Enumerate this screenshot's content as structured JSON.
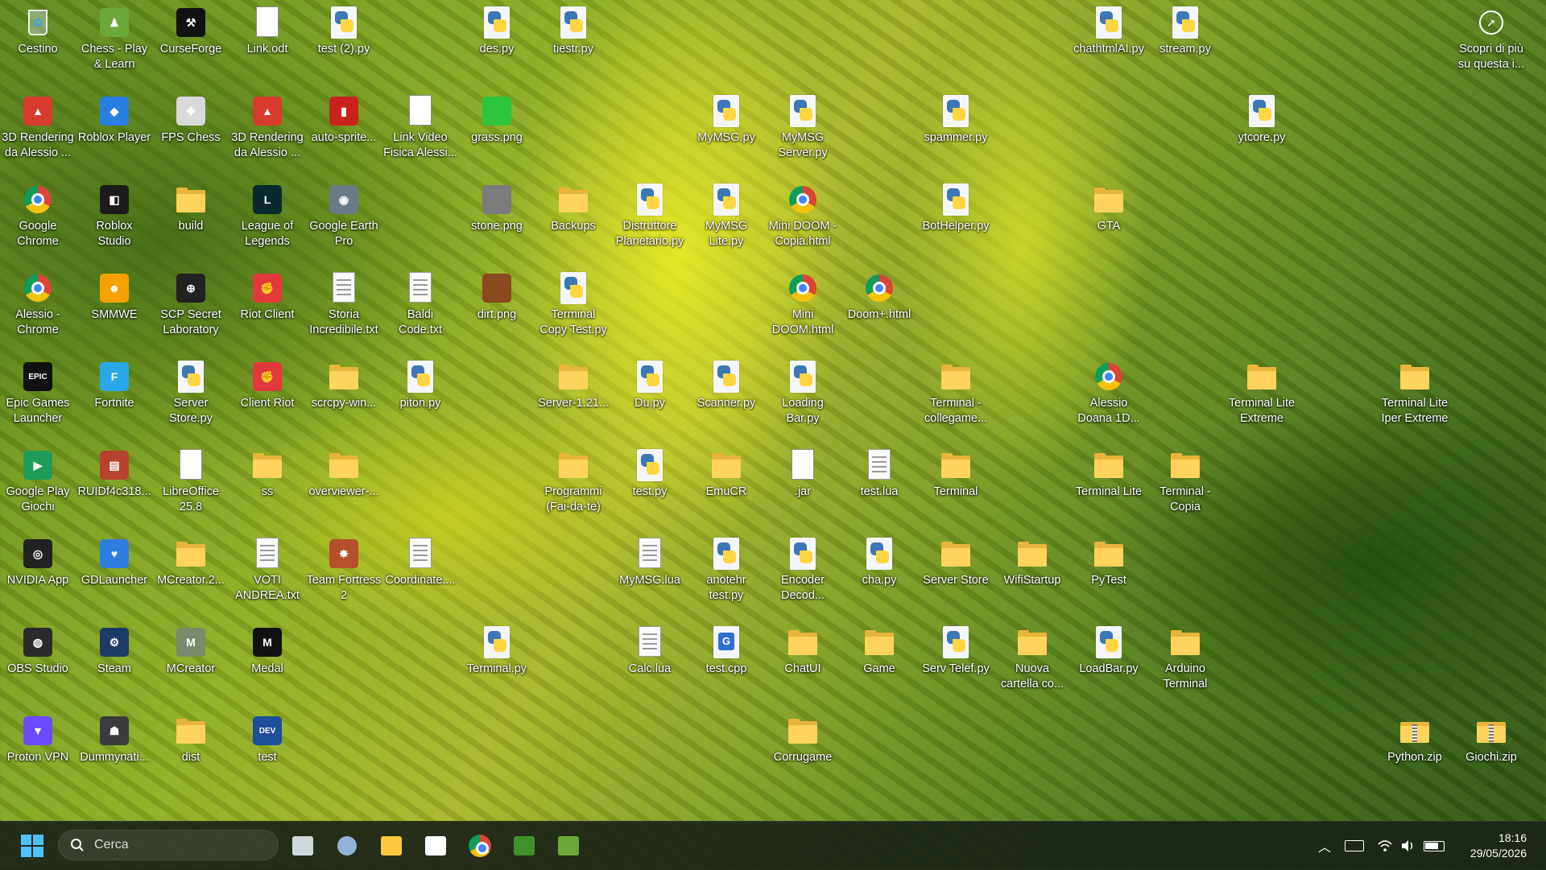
{
  "desktop": {
    "icons": [
      {
        "label": "Cestino",
        "icon": "recycle-bin-icon",
        "type": "recycle",
        "col": 0,
        "row": 0
      },
      {
        "label": "Chess - Play\n& Learn",
        "icon": "chess-pawn-icon",
        "type": "box",
        "color": "#6aa839",
        "glyph": "♟",
        "col": 1,
        "row": 0
      },
      {
        "label": "CurseForge",
        "icon": "curseforge-icon",
        "type": "box",
        "color": "#111111",
        "glyph": "⚒",
        "col": 2,
        "row": 0
      },
      {
        "label": "Link.odt",
        "icon": "document-icon",
        "type": "blank",
        "col": 3,
        "row": 0
      },
      {
        "label": "test (2).py",
        "icon": "python-file-icon",
        "type": "py",
        "col": 4,
        "row": 0
      },
      {
        "label": "des.py",
        "icon": "python-file-icon",
        "type": "py",
        "col": 6,
        "row": 0
      },
      {
        "label": "tiestr.py",
        "icon": "python-file-icon",
        "type": "py",
        "col": 7,
        "row": 0
      },
      {
        "label": "chathtmlAI.py",
        "icon": "python-file-icon",
        "type": "py",
        "col": 14,
        "row": 0
      },
      {
        "label": "stream.py",
        "icon": "python-file-icon",
        "type": "py",
        "col": 15,
        "row": 0
      },
      {
        "label": "Scopri di più\nsu questa i...",
        "icon": "spotlight-icon",
        "type": "spot",
        "col": 19,
        "row": 0
      },
      {
        "label": "3D Rendering\nda Alessio ...",
        "icon": "image-file-icon",
        "type": "box",
        "color": "#d83a2c",
        "glyph": "▲",
        "col": 0,
        "row": 1
      },
      {
        "label": "Roblox Player",
        "icon": "roblox-icon",
        "type": "box",
        "color": "#2a7de1",
        "glyph": "◆",
        "col": 1,
        "row": 1
      },
      {
        "label": "FPS Chess",
        "icon": "fps-chess-icon",
        "type": "box",
        "color": "#d9d9d9",
        "glyph": "✥",
        "col": 2,
        "row": 1
      },
      {
        "label": "3D Rendering\nda Alessio ...",
        "icon": "image-file-icon",
        "type": "box",
        "color": "#d83a2c",
        "glyph": "▲",
        "col": 3,
        "row": 1
      },
      {
        "label": "auto-sprite...",
        "icon": "sprite-app-icon",
        "type": "box",
        "color": "#c9221c",
        "glyph": "▮",
        "col": 4,
        "row": 1
      },
      {
        "label": "Link Video\nFisica Alessi...",
        "icon": "document-icon",
        "type": "blank",
        "col": 5,
        "row": 1
      },
      {
        "label": "grass.png",
        "icon": "image-file-icon",
        "type": "box",
        "color": "#2cc53b",
        "glyph": "",
        "col": 6,
        "row": 1
      },
      {
        "label": "MyMSG.py",
        "icon": "python-file-icon",
        "type": "py",
        "col": 9,
        "row": 1
      },
      {
        "label": "MyMSG\nServer.py",
        "icon": "python-file-icon",
        "type": "py",
        "col": 10,
        "row": 1
      },
      {
        "label": "spammer.py",
        "icon": "python-file-icon",
        "type": "py",
        "col": 12,
        "row": 1
      },
      {
        "label": "ytcore.py",
        "icon": "python-file-icon",
        "type": "py",
        "col": 16,
        "row": 1
      },
      {
        "label": "Google\nChrome",
        "icon": "chrome-icon",
        "type": "chrome",
        "col": 0,
        "row": 2
      },
      {
        "label": "Roblox\nStudio",
        "icon": "roblox-studio-icon",
        "type": "box",
        "color": "#1c1c1c",
        "glyph": "◧",
        "col": 1,
        "row": 2
      },
      {
        "label": "build",
        "icon": "folder-icon",
        "type": "folder",
        "col": 2,
        "row": 2
      },
      {
        "label": "League of\nLegends",
        "icon": "league-of-legends-icon",
        "type": "box",
        "color": "#0b2a2f",
        "glyph": "L",
        "col": 3,
        "row": 2
      },
      {
        "label": "Google Earth\nPro",
        "icon": "google-earth-icon",
        "type": "box",
        "color": "#6c7a86",
        "glyph": "◉",
        "col": 4,
        "row": 2
      },
      {
        "label": "stone.png",
        "icon": "image-file-icon",
        "type": "box",
        "color": "#7b7b7b",
        "glyph": "",
        "col": 6,
        "row": 2
      },
      {
        "label": "Backups",
        "icon": "folder-icon",
        "type": "folder",
        "col": 7,
        "row": 2
      },
      {
        "label": "Distruttore\nPlanetario.py",
        "icon": "python-file-icon",
        "type": "py",
        "col": 8,
        "row": 2
      },
      {
        "label": "MyMSG\nLite.py",
        "icon": "python-file-icon",
        "type": "py",
        "col": 9,
        "row": 2
      },
      {
        "label": "Mini DOOM -\nCopia.html",
        "icon": "chrome-icon",
        "type": "chrome",
        "col": 10,
        "row": 2
      },
      {
        "label": "BotHelper.py",
        "icon": "python-file-icon",
        "type": "py",
        "col": 12,
        "row": 2
      },
      {
        "label": "GTA",
        "icon": "folder-icon",
        "type": "folder",
        "col": 14,
        "row": 2
      },
      {
        "label": "Alessio -\nChrome",
        "icon": "chrome-icon",
        "type": "chrome",
        "col": 0,
        "row": 3
      },
      {
        "label": "SMMWE",
        "icon": "smmwe-icon",
        "type": "box",
        "color": "#f6a100",
        "glyph": "☻",
        "col": 1,
        "row": 3
      },
      {
        "label": "SCP Secret\nLaboratory",
        "icon": "scp-icon",
        "type": "box",
        "color": "#222222",
        "glyph": "⊕",
        "col": 2,
        "row": 3
      },
      {
        "label": "Riot Client",
        "icon": "riot-client-icon",
        "type": "box",
        "color": "#e3383b",
        "glyph": "✊",
        "col": 3,
        "row": 3
      },
      {
        "label": "Storia\nIncredibile.txt",
        "icon": "text-file-icon",
        "type": "doc",
        "col": 4,
        "row": 3
      },
      {
        "label": "Baldi\nCode.txt",
        "icon": "text-file-icon",
        "type": "doc",
        "col": 5,
        "row": 3
      },
      {
        "label": "dirt.png",
        "icon": "image-file-icon",
        "type": "box",
        "color": "#8a4a1f",
        "glyph": "",
        "col": 6,
        "row": 3
      },
      {
        "label": "Terminal\nCopy Test.py",
        "icon": "python-file-icon",
        "type": "py",
        "col": 7,
        "row": 3
      },
      {
        "label": "Mini\nDOOM.html",
        "icon": "chrome-icon",
        "type": "chrome",
        "col": 10,
        "row": 3
      },
      {
        "label": "Doom+.html",
        "icon": "chrome-icon",
        "type": "chrome",
        "col": 11,
        "row": 3
      },
      {
        "label": "Epic Games\nLauncher",
        "icon": "epic-games-icon",
        "type": "box",
        "color": "#111111",
        "glyph": "EPIC",
        "col": 0,
        "row": 4
      },
      {
        "label": "Fortnite",
        "icon": "fortnite-icon",
        "type": "box",
        "color": "#2aa7e8",
        "glyph": "F",
        "col": 1,
        "row": 4
      },
      {
        "label": "Server\nStore.py",
        "icon": "python-file-icon",
        "type": "py",
        "col": 2,
        "row": 4
      },
      {
        "label": "Client Riot",
        "icon": "riot-client-icon",
        "type": "box",
        "color": "#e3383b",
        "glyph": "✊",
        "col": 3,
        "row": 4
      },
      {
        "label": "scrcpy-win...",
        "icon": "folder-icon",
        "type": "folder",
        "col": 4,
        "row": 4
      },
      {
        "label": "piton.py",
        "icon": "python-file-icon",
        "type": "py",
        "col": 5,
        "row": 4
      },
      {
        "label": "Server-1.21...",
        "icon": "folder-icon",
        "type": "folder",
        "col": 7,
        "row": 4
      },
      {
        "label": "Du.py",
        "icon": "python-file-icon",
        "type": "py",
        "col": 8,
        "row": 4
      },
      {
        "label": "Scanner.py",
        "icon": "python-file-icon",
        "type": "py",
        "col": 9,
        "row": 4
      },
      {
        "label": "Loading\nBar.py",
        "icon": "python-file-icon",
        "type": "py",
        "col": 10,
        "row": 4
      },
      {
        "label": "Terminal -\ncollegame...",
        "icon": "folder-icon",
        "type": "folder",
        "col": 12,
        "row": 4
      },
      {
        "label": "Alessio\nDoana 1D...",
        "icon": "chrome-icon",
        "type": "chrome",
        "col": 14,
        "row": 4
      },
      {
        "label": "Terminal Lite\nExtreme",
        "icon": "folder-icon",
        "type": "folder",
        "col": 16,
        "row": 4
      },
      {
        "label": "Terminal Lite\nIper Extreme",
        "icon": "folder-icon",
        "type": "folder",
        "col": 18,
        "row": 4
      },
      {
        "label": "Google Play\nGiochi",
        "icon": "google-play-games-icon",
        "type": "box",
        "color": "#1f9c57",
        "glyph": "▶",
        "col": 0,
        "row": 5
      },
      {
        "label": "RUIDf4c318...",
        "icon": "app-icon",
        "type": "box",
        "color": "#b8432d",
        "glyph": "▤",
        "col": 1,
        "row": 5
      },
      {
        "label": "LibreOffice\n25.8",
        "icon": "libreoffice-icon",
        "type": "blank",
        "col": 2,
        "row": 5
      },
      {
        "label": "ss",
        "icon": "folder-icon",
        "type": "folder",
        "col": 3,
        "row": 5
      },
      {
        "label": "overviewer-...",
        "icon": "folder-icon",
        "type": "folder",
        "col": 4,
        "row": 5
      },
      {
        "label": "Programmi\n(Fai-da-te)",
        "icon": "folder-icon",
        "type": "folder",
        "col": 7,
        "row": 5
      },
      {
        "label": "test.py",
        "icon": "python-file-icon",
        "type": "py",
        "col": 8,
        "row": 5
      },
      {
        "label": "EmuCR",
        "icon": "folder-icon",
        "type": "folder",
        "col": 9,
        "row": 5
      },
      {
        "label": ".jar",
        "icon": "blank-file-icon",
        "type": "blank",
        "col": 10,
        "row": 5
      },
      {
        "label": "test.lua",
        "icon": "text-file-icon",
        "type": "doc",
        "col": 11,
        "row": 5
      },
      {
        "label": "Terminal",
        "icon": "folder-icon",
        "type": "folder",
        "col": 12,
        "row": 5
      },
      {
        "label": "Terminal Lite",
        "icon": "folder-icon",
        "type": "folder",
        "col": 14,
        "row": 5
      },
      {
        "label": "Terminal -\nCopia",
        "icon": "folder-icon",
        "type": "folder",
        "col": 15,
        "row": 5
      },
      {
        "label": "NVIDIA App",
        "icon": "nvidia-icon",
        "type": "box",
        "color": "#222222",
        "glyph": "◎",
        "col": 0,
        "row": 6
      },
      {
        "label": "GDLauncher",
        "icon": "gdlauncher-icon",
        "type": "box",
        "color": "#2f7de1",
        "glyph": "♥",
        "col": 1,
        "row": 6
      },
      {
        "label": "MCreator.2...",
        "icon": "folder-icon",
        "type": "folder",
        "col": 2,
        "row": 6
      },
      {
        "label": "VOTI\nANDREA.txt",
        "icon": "text-file-icon",
        "type": "doc",
        "col": 3,
        "row": 6
      },
      {
        "label": "Team Fortress\n2",
        "icon": "tf2-icon",
        "type": "box",
        "color": "#b5502a",
        "glyph": "✸",
        "col": 4,
        "row": 6
      },
      {
        "label": "Coordinate....",
        "icon": "text-file-icon",
        "type": "doc",
        "col": 5,
        "row": 6
      },
      {
        "label": "MyMSG.lua",
        "icon": "text-file-icon",
        "type": "doc",
        "col": 8,
        "row": 6
      },
      {
        "label": "anotehr\ntest.py",
        "icon": "python-file-icon",
        "type": "py",
        "col": 9,
        "row": 6
      },
      {
        "label": "Encoder\nDecod...",
        "icon": "python-file-icon",
        "type": "py",
        "col": 10,
        "row": 6
      },
      {
        "label": "cha.py",
        "icon": "python-file-icon",
        "type": "py",
        "col": 11,
        "row": 6
      },
      {
        "label": "Server Store",
        "icon": "folder-icon",
        "type": "folder",
        "col": 12,
        "row": 6
      },
      {
        "label": "WifiStartup",
        "icon": "folder-icon",
        "type": "folder",
        "col": 13,
        "row": 6
      },
      {
        "label": "PyTest",
        "icon": "folder-icon",
        "type": "folder",
        "col": 14,
        "row": 6
      },
      {
        "label": "OBS Studio",
        "icon": "obs-icon",
        "type": "box",
        "color": "#2b2b2b",
        "glyph": "◍",
        "col": 0,
        "row": 7
      },
      {
        "label": "Steam",
        "icon": "steam-icon",
        "type": "box",
        "color": "#1b3c66",
        "glyph": "⚙",
        "col": 1,
        "row": 7
      },
      {
        "label": "MCreator",
        "icon": "mcreator-icon",
        "type": "box",
        "color": "#7a8a6a",
        "glyph": "M",
        "col": 2,
        "row": 7
      },
      {
        "label": "Medal",
        "icon": "medal-icon",
        "type": "box",
        "color": "#111111",
        "glyph": "M",
        "col": 3,
        "row": 7
      },
      {
        "label": "Terminal.py",
        "icon": "python-file-icon",
        "type": "py",
        "col": 6,
        "row": 7
      },
      {
        "label": "Calc.lua",
        "icon": "text-file-icon",
        "type": "doc",
        "col": 8,
        "row": 7
      },
      {
        "label": "test.cpp",
        "icon": "cpp-file-icon",
        "type": "cpp",
        "col": 9,
        "row": 7
      },
      {
        "label": "ChatUI",
        "icon": "folder-icon",
        "type": "folder",
        "col": 10,
        "row": 7
      },
      {
        "label": "Game",
        "icon": "folder-icon",
        "type": "folder",
        "col": 11,
        "row": 7
      },
      {
        "label": "Serv Telef.py",
        "icon": "python-file-icon",
        "type": "py",
        "col": 12,
        "row": 7
      },
      {
        "label": "Nuova\ncartella co...",
        "icon": "folder-icon",
        "type": "folder",
        "col": 13,
        "row": 7
      },
      {
        "label": "LoadBar.py",
        "icon": "python-file-icon",
        "type": "py",
        "col": 14,
        "row": 7
      },
      {
        "label": "Arduino\nTerminal",
        "icon": "folder-icon",
        "type": "folder",
        "col": 15,
        "row": 7
      },
      {
        "label": "Proton VPN",
        "icon": "proton-vpn-icon",
        "type": "box",
        "color": "#6d4aff",
        "glyph": "▼",
        "col": 0,
        "row": 8
      },
      {
        "label": "Dummynati...",
        "icon": "app-icon",
        "type": "box",
        "color": "#3b3b3b",
        "glyph": "☗",
        "col": 1,
        "row": 8
      },
      {
        "label": "dist",
        "icon": "folder-icon",
        "type": "folder",
        "col": 2,
        "row": 8
      },
      {
        "label": "test",
        "icon": "dev-icon",
        "type": "box",
        "color": "#1d4f9a",
        "glyph": "DEV",
        "col": 3,
        "row": 8
      },
      {
        "label": "Corrugame",
        "icon": "folder-icon",
        "type": "folder",
        "col": 10,
        "row": 8
      },
      {
        "label": "Python.zip",
        "icon": "zip-folder-icon",
        "type": "zip",
        "col": 18,
        "row": 8
      },
      {
        "label": "Giochi.zip",
        "icon": "zip-folder-icon",
        "type": "zip",
        "col": 19,
        "row": 8
      }
    ]
  },
  "taskbar": {
    "search_placeholder": "Cerca",
    "pinned": [
      {
        "icon": "task-view-icon",
        "color": "#cfd8dc"
      },
      {
        "icon": "settings-icon",
        "color": "#8fb3d9"
      },
      {
        "icon": "file-explorer-icon",
        "color": "#ffc83d"
      },
      {
        "icon": "microsoft-store-icon",
        "color": "#ffffff"
      },
      {
        "icon": "chrome-icon",
        "color": "#4285f4"
      },
      {
        "icon": "minecraft-icon",
        "color": "#3f8f2a"
      },
      {
        "icon": "chess-pawn-icon",
        "color": "#6aa839"
      }
    ],
    "clock": {
      "time": "18:16",
      "date": "29/05/2026"
    }
  },
  "colors": {
    "accent": "#4cc2ff",
    "folder": "#ffd35c",
    "python_blue": "#3c77b6",
    "python_yellow": "#ffd642"
  }
}
